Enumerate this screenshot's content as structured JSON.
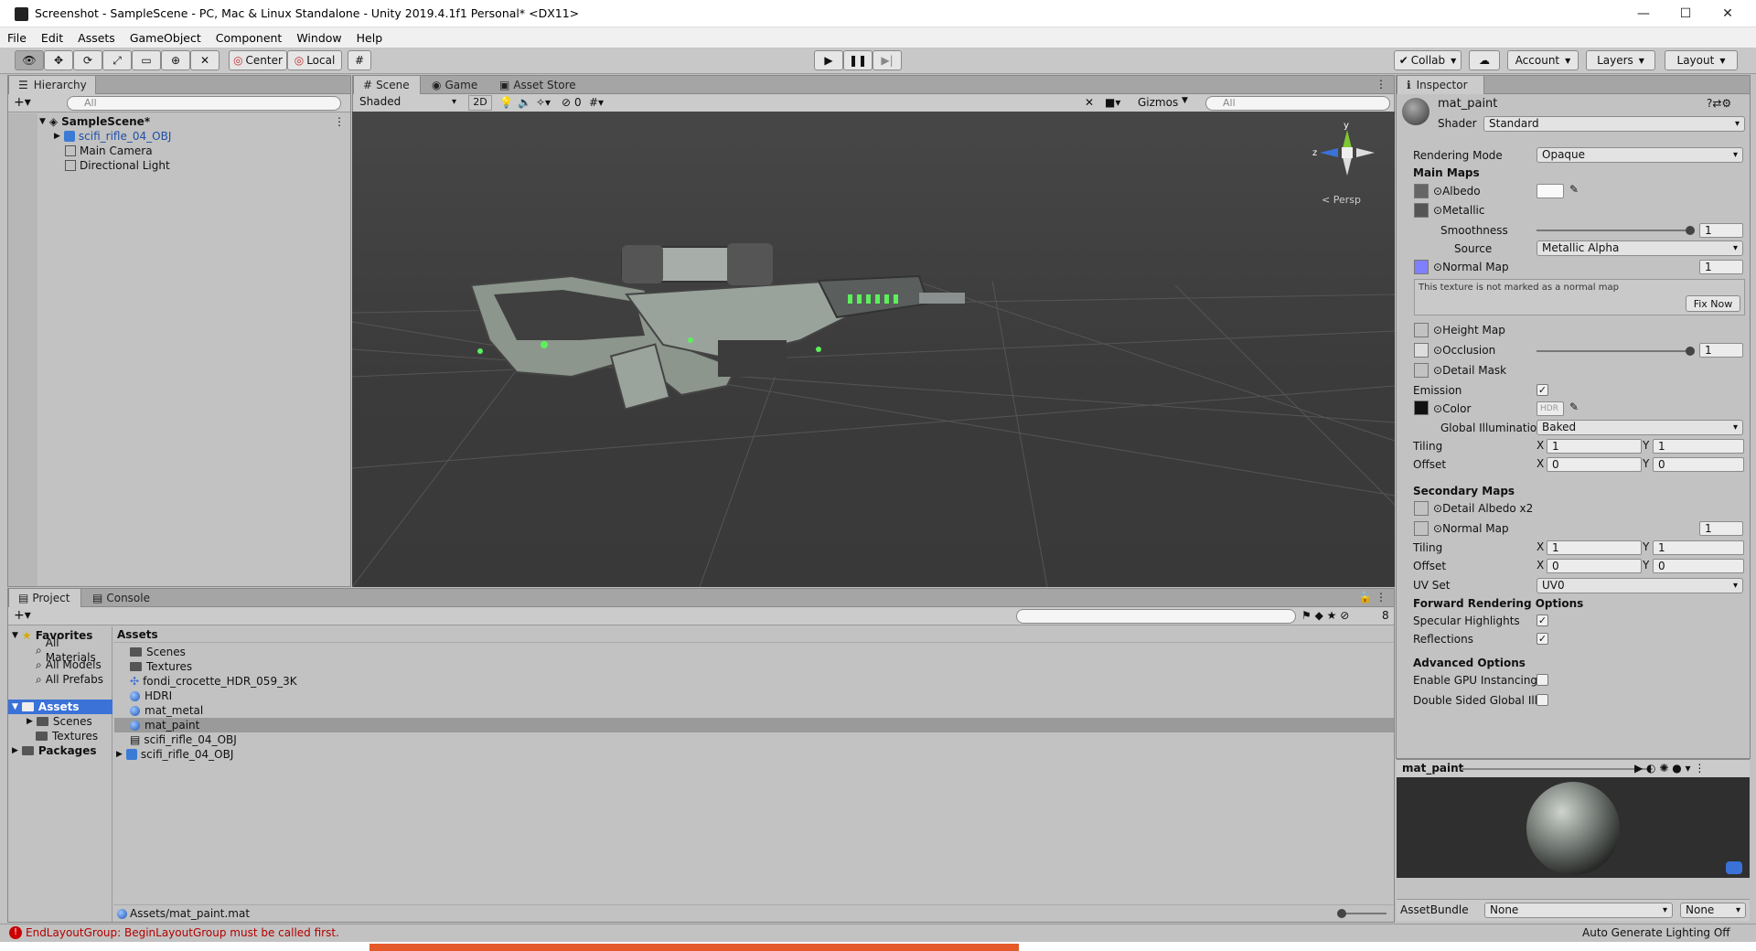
{
  "window": {
    "title": "Screenshot - SampleScene - PC, Mac & Linux Standalone - Unity 2019.4.1f1 Personal* <DX11>"
  },
  "menu": [
    "File",
    "Edit",
    "Assets",
    "GameObject",
    "Component",
    "Window",
    "Help"
  ],
  "toolbar": {
    "pivot": "Center",
    "space": "Local",
    "collab": "Collab",
    "account": "Account",
    "layers": "Layers",
    "layout": "Layout"
  },
  "hierarchy": {
    "tab": "Hierarchy",
    "search_placeholder": "All",
    "scene": "SampleScene*",
    "items": [
      "scifi_rifle_04_OBJ",
      "Main Camera",
      "Directional Light"
    ]
  },
  "scene": {
    "tabs": [
      "Scene",
      "Game",
      "Asset Store"
    ],
    "shading": "Shaded",
    "mode_2d": "2D",
    "hidden_count": "0",
    "gizmos": "Gizmos",
    "search_placeholder": "All",
    "persp": "< Persp",
    "axis": {
      "y": "y",
      "z": "z"
    }
  },
  "inspector": {
    "tab": "Inspector",
    "material_name": "mat_paint",
    "shader_label": "Shader",
    "shader": "Standard",
    "rendering_mode_label": "Rendering Mode",
    "rendering_mode": "Opaque",
    "main_maps": "Main Maps",
    "albedo": "Albedo",
    "metallic": "Metallic",
    "smoothness": "Smoothness",
    "smoothness_value": "1",
    "source": "Source",
    "source_value": "Metallic Alpha",
    "normal_map": "Normal Map",
    "normal_value": "1",
    "warning": "This texture is not marked as a normal map",
    "fix_now": "Fix Now",
    "height_map": "Height Map",
    "occlusion": "Occlusion",
    "occlusion_value": "1",
    "detail_mask": "Detail Mask",
    "emission": "Emission",
    "color": "Color",
    "hdr": "HDR",
    "gi_label": "Global Illumination",
    "gi_value": "Baked",
    "tiling": "Tiling",
    "offset": "Offset",
    "x": "X",
    "y": "Y",
    "tiling_x": "1",
    "tiling_y": "1",
    "offset_x": "0",
    "offset_y": "0",
    "secondary_maps": "Secondary Maps",
    "detail_albedo": "Detail Albedo x2",
    "normal_map2": "Normal Map",
    "normal2_value": "1",
    "tiling2_x": "1",
    "tiling2_y": "1",
    "offset2_x": "0",
    "offset2_y": "0",
    "uv_set": "UV Set",
    "uv_value": "UV0",
    "forward": "Forward Rendering Options",
    "specular": "Specular Highlights",
    "reflections": "Reflections",
    "advanced": "Advanced Options",
    "gpu_instancing": "Enable GPU Instancing",
    "double_sided": "Double Sided Global Illu",
    "preview_name": "mat_paint",
    "asset_bundle": "AssetBundle",
    "bundle_value": "None",
    "bundle_variant": "None",
    "auto_lighting": "Auto Generate Lighting Off"
  },
  "project": {
    "tabs": [
      "Project",
      "Console"
    ],
    "favorites": "Favorites",
    "fav_items": [
      "All Materials",
      "All Models",
      "All Prefabs"
    ],
    "assets_root": "Assets",
    "asset_folders": [
      "Scenes",
      "Textures"
    ],
    "packages": "Packages",
    "breadcrumb": "Assets",
    "files": [
      {
        "name": "Scenes",
        "kind": "folder"
      },
      {
        "name": "Textures",
        "kind": "folder"
      },
      {
        "name": "fondi_crocette_HDR_059_3K",
        "kind": "texture"
      },
      {
        "name": "HDRI",
        "kind": "material"
      },
      {
        "name": "mat_metal",
        "kind": "material"
      },
      {
        "name": "mat_paint",
        "kind": "material"
      },
      {
        "name": "scifi_rifle_04_OBJ",
        "kind": "file"
      },
      {
        "name": "scifi_rifle_04_OBJ",
        "kind": "model"
      }
    ],
    "hidden_count": "8",
    "path": "Assets/mat_paint.mat"
  },
  "status": {
    "error": "EndLayoutGroup: BeginLayoutGroup must be called first."
  },
  "colors": {
    "accent": "#3a72d8",
    "error": "#b30000",
    "selection": "#9a9a9a"
  }
}
